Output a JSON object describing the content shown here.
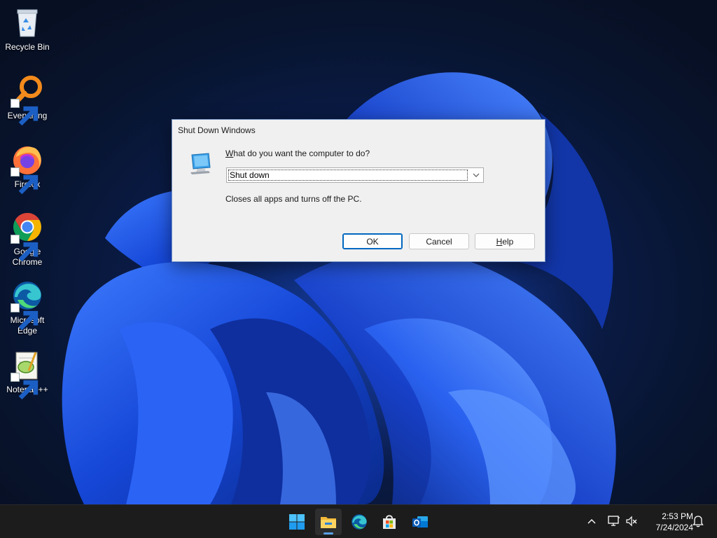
{
  "desktop": {
    "icons": [
      {
        "label": "Recycle Bin",
        "icon": "recycle-bin-icon"
      },
      {
        "label": "Everything",
        "icon": "everything-search-icon"
      },
      {
        "label": "Firefox",
        "icon": "firefox-icon"
      },
      {
        "label": "Google Chrome",
        "icon": "chrome-icon"
      },
      {
        "label": "Microsoft Edge",
        "icon": "edge-icon"
      },
      {
        "label": "Notepad++",
        "icon": "notepad-plus-plus-icon"
      }
    ]
  },
  "dialog": {
    "title": "Shut Down Windows",
    "question": "What do you want the computer to do?",
    "question_mnemonic": "W",
    "question_rest": "hat do you want the computer to do?",
    "selected_option": "Shut down",
    "description": "Closes all apps and turns off the PC.",
    "buttons": {
      "ok": "OK",
      "cancel": "Cancel",
      "help": "Help",
      "help_mnemonic": "H",
      "help_rest": "elp"
    }
  },
  "taskbar": {
    "apps": [
      {
        "name": "Start",
        "icon": "windows-start-icon"
      },
      {
        "name": "File Explorer",
        "icon": "file-explorer-icon",
        "active": true
      },
      {
        "name": "Microsoft Edge",
        "icon": "edge-icon"
      },
      {
        "name": "Microsoft Store",
        "icon": "store-icon"
      },
      {
        "name": "Outlook (new)",
        "icon": "outlook-icon"
      }
    ],
    "tray": {
      "icons": [
        "chevron-up-icon",
        "network-icon",
        "volume-muted-icon",
        "notification-bell-icon"
      ]
    },
    "clock": {
      "time": "2:53 PM",
      "date": "7/24/2024"
    }
  },
  "colors": {
    "accent": "#0067c0",
    "taskbar_bg": "#1c1c1c",
    "dialog_bg": "#f0f0f0"
  }
}
